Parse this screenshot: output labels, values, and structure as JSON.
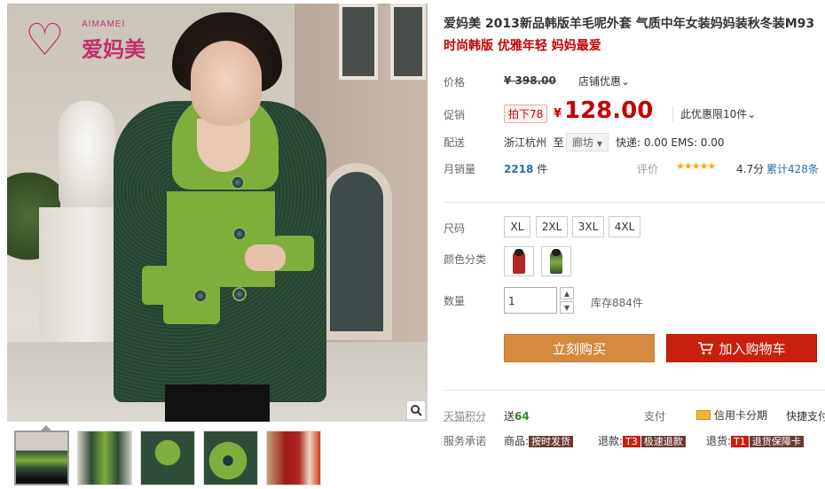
{
  "brand": {
    "name_en": "AIMAMEI",
    "name_cn": "爱妈美"
  },
  "product": {
    "title": "爱妈美 2013新品韩版羊毛呢外套 气质中年女装妈妈装秋冬装M93",
    "subtitle": "时尚韩版 优雅年轻 妈妈最爱"
  },
  "price": {
    "label": "价格",
    "original": "¥ 398.00",
    "store_promo": "店铺优惠",
    "promo_label": "促销",
    "promo_tag": "拍下78",
    "promo_currency": "¥",
    "promo_value": "128.00",
    "promo_limit": "此优惠限10件"
  },
  "shipping": {
    "label": "配送",
    "from": "浙江杭州",
    "to_prefix": "至",
    "to": "廊坊",
    "fee": "快递: 0.00 EMS: 0.00"
  },
  "sales": {
    "label": "月销量",
    "count": "2218",
    "unit": "件",
    "review_label": "评价",
    "stars": "★★★★★",
    "rating": "4.7分",
    "review_count": "累计428条",
    "rating_value": 4.7
  },
  "options": {
    "size_label": "尺码",
    "sizes": [
      "XL",
      "2XL",
      "3XL",
      "4XL"
    ],
    "color_label": "颜色分类",
    "qty_label": "数量",
    "qty_value": "1",
    "stock": "库存884件"
  },
  "actions": {
    "buy": "立刻购买",
    "cart": "加入购物车"
  },
  "tmall": {
    "points_label": "天猫积分",
    "points_prefix": "送",
    "points_value": "64",
    "pay_label": "支付",
    "credit": "信用卡分期",
    "express_pay": "快捷支付"
  },
  "service": {
    "label": "服务承诺",
    "goods_prefix": "商品:",
    "goods_text": "按时发货",
    "refund_prefix": "退款:",
    "refund_tag": "T3",
    "refund_text": "极速退款",
    "return_prefix": "退货:",
    "return_tag": "T1",
    "return_text": "退货保障卡"
  },
  "colors": {
    "price_red": "#c40000",
    "buy_orange": "#d68a3f",
    "cart_red": "#c8200d",
    "coat_green": "#7fae3c"
  },
  "icons": [
    "zoom-icon",
    "cart-icon",
    "credit-card-icon",
    "chevron-down-icon",
    "spinner-up-icon",
    "spinner-down-icon"
  ]
}
